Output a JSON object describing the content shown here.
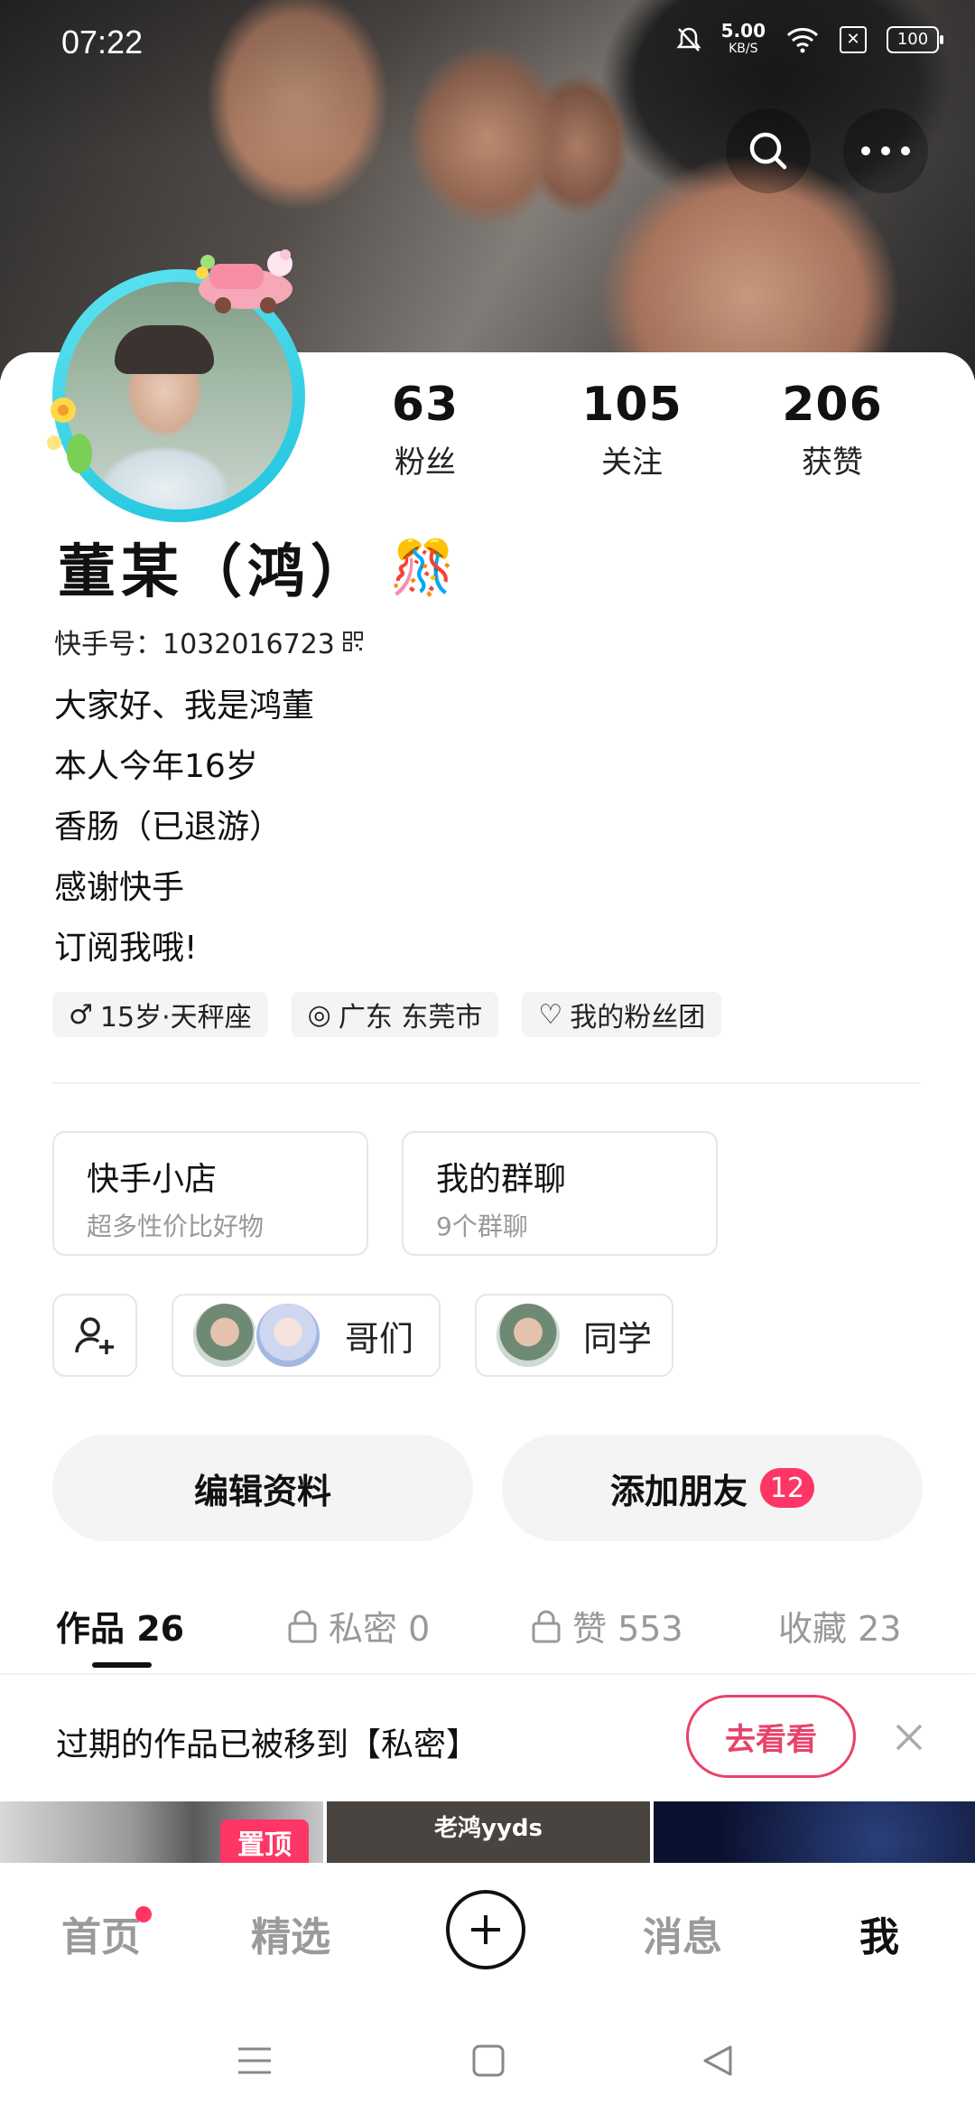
{
  "status_bar": {
    "time": "07:22",
    "net_speed": "5.00",
    "net_unit": "KB/S",
    "battery": "100"
  },
  "header": {
    "search_icon": "search-icon",
    "more_icon": "more-icon"
  },
  "profile": {
    "stats": [
      {
        "value": "63",
        "label": "粉丝"
      },
      {
        "value": "105",
        "label": "关注"
      },
      {
        "value": "206",
        "label": "获赞"
      }
    ],
    "name": "董某（鸿）",
    "name_emoji": "🎊",
    "kuaishou_id": "快手号：1032016723",
    "bio": [
      "大家好、我是鸿董",
      "本人今年16岁",
      "香肠（已退游）",
      "感谢快手",
      "订阅我哦!"
    ],
    "tags": [
      {
        "icon": "male-icon",
        "symbol": "♂",
        "text": "15岁·天秤座"
      },
      {
        "icon": "location-icon",
        "symbol": "◎",
        "text": "广东 东莞市"
      },
      {
        "icon": "heart-icon",
        "symbol": "♡",
        "text": "我的粉丝团"
      }
    ]
  },
  "shortcuts": {
    "shop": {
      "title": "快手小店",
      "subtitle": "超多性价比好物"
    },
    "group_chat": {
      "title": "我的群聊",
      "subtitle": "9个群聊"
    }
  },
  "groups": [
    {
      "label": "哥们"
    },
    {
      "label": "同学"
    }
  ],
  "actions": {
    "edit_profile": "编辑资料",
    "add_friend": "添加朋友",
    "add_friend_badge": "12"
  },
  "tabs": [
    {
      "label": "作品 26",
      "locked": false,
      "active": true
    },
    {
      "label": "私密 0",
      "locked": true,
      "active": false
    },
    {
      "label": "赞 553",
      "locked": true,
      "active": false
    },
    {
      "label": "收藏 23",
      "locked": false,
      "active": false
    }
  ],
  "notice": {
    "text": "过期的作品已被移到【私密】",
    "button": "去看看"
  },
  "thumbnails": {
    "pinned_label": "置顶",
    "second_caption": "老鸿yyds"
  },
  "bottom_nav": [
    {
      "label": "首页",
      "active": false
    },
    {
      "label": "精选",
      "active": false
    },
    {
      "label": "消息",
      "active": false
    },
    {
      "label": "我",
      "active": true
    }
  ],
  "colors": {
    "accent": "#fe3666",
    "notice_button": "#e8426a",
    "avatar_ring": "#1ec4de"
  }
}
